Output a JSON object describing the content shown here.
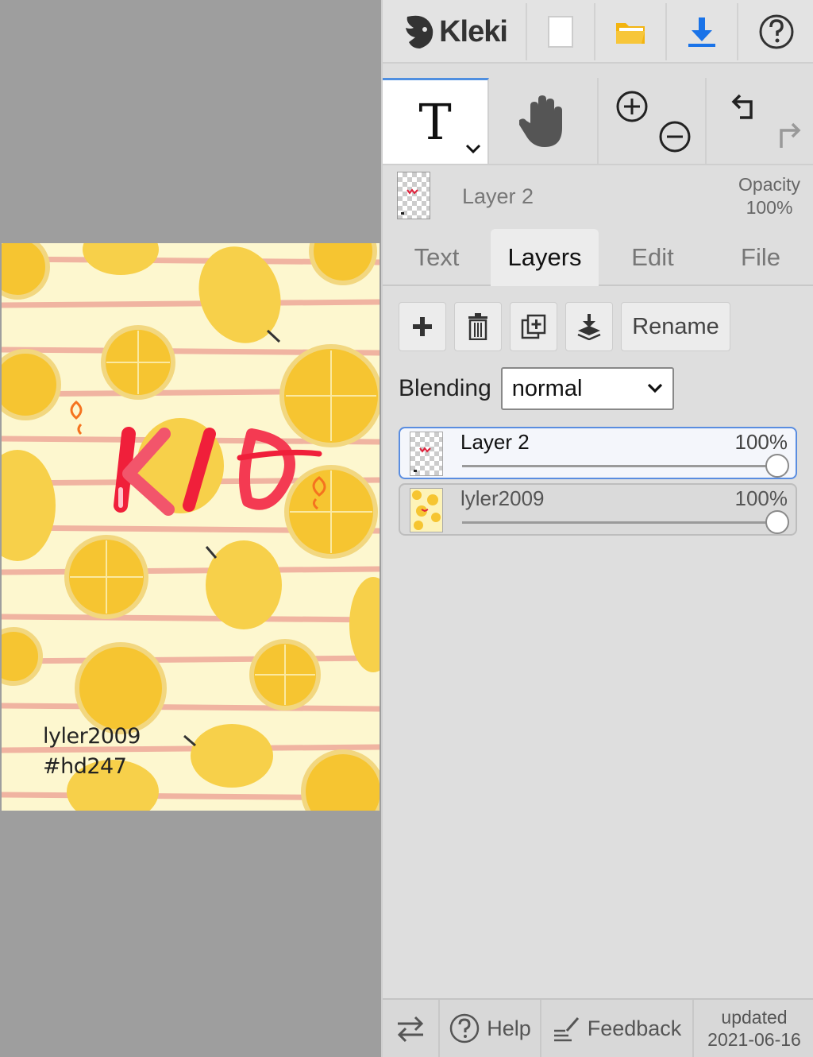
{
  "app": {
    "name": "Kleki",
    "colors": {
      "panel": "#dedede",
      "accent": "#4f8fe0",
      "download": "#1a73e8",
      "folder": "#f3b40f"
    }
  },
  "toolbar": {
    "icons": [
      "new-document-icon",
      "open-folder-icon",
      "download-icon",
      "help-icon"
    ]
  },
  "tools": {
    "active_glyph": "T",
    "items": [
      "text-tool",
      "hand-tool",
      "zoom-in",
      "zoom-out",
      "undo",
      "redo"
    ]
  },
  "current_layer": {
    "name": "Layer 2",
    "opacity_label": "Opacity",
    "opacity_value": "100%"
  },
  "tabs": [
    {
      "label": "Text",
      "active": false
    },
    {
      "label": "Layers",
      "active": true
    },
    {
      "label": "Edit",
      "active": false
    },
    {
      "label": "File",
      "active": false
    }
  ],
  "layer_actions": {
    "rename_label": "Rename"
  },
  "blending": {
    "label": "Blending",
    "value": "normal"
  },
  "layers": [
    {
      "name": "Layer 2",
      "opacity": "100%",
      "level": 1.0,
      "selected": true
    },
    {
      "name": "lyler2009",
      "opacity": "100%",
      "level": 1.0,
      "selected": false
    }
  ],
  "canvas": {
    "title_art": "KIO",
    "signature_line1": "lyler2009",
    "signature_line2": "#hd247"
  },
  "footer": {
    "help_label": "Help",
    "feedback_label": "Feedback",
    "updated_label": "updated",
    "updated_date": "2021-06-16"
  }
}
